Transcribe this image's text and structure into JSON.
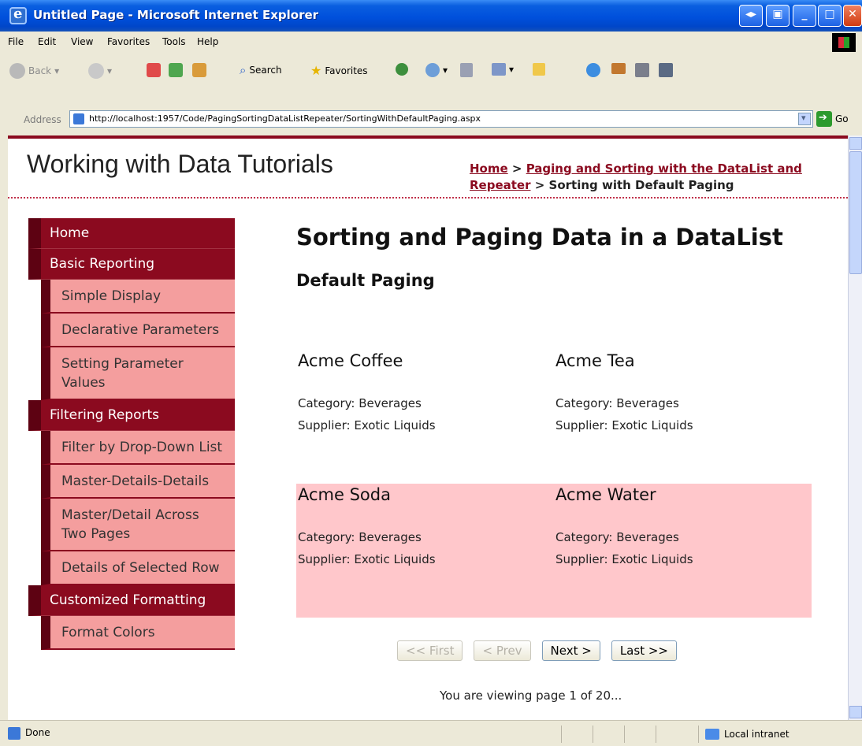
{
  "window": {
    "title": "Untitled Page - Microsoft Internet Explorer"
  },
  "menu": [
    "File",
    "Edit",
    "View",
    "Favorites",
    "Tools",
    "Help"
  ],
  "toolbar": {
    "back": "Back",
    "search": "Search",
    "favorites": "Favorites"
  },
  "address": {
    "label": "Address",
    "url": "http://localhost:1957/Code/PagingSortingDataListRepeater/SortingWithDefaultPaging.aspx",
    "go": "Go"
  },
  "site": {
    "title": "Working with Data Tutorials"
  },
  "breadcrumb": {
    "home": "Home",
    "sep1": " > ",
    "parent": "Paging and Sorting with the DataList and Repeater",
    "sep2": " > ",
    "current": "Sorting with Default Paging"
  },
  "sidebar": [
    {
      "label": "Home",
      "type": "section"
    },
    {
      "label": "Basic Reporting",
      "type": "section"
    },
    {
      "label": "Simple Display",
      "type": "sub"
    },
    {
      "label": "Declarative Parameters",
      "type": "sub"
    },
    {
      "label": "Setting Parameter Values",
      "type": "sub"
    },
    {
      "label": "Filtering Reports",
      "type": "section"
    },
    {
      "label": "Filter by Drop-Down List",
      "type": "sub"
    },
    {
      "label": "Master-Details-Details",
      "type": "sub"
    },
    {
      "label": "Master/Detail Across Two Pages",
      "type": "sub"
    },
    {
      "label": "Details of Selected Row",
      "type": "sub"
    },
    {
      "label": "Customized Formatting",
      "type": "section"
    },
    {
      "label": "Format Colors",
      "type": "sub"
    }
  ],
  "main": {
    "heading": "Sorting and Paging Data in a DataList",
    "subheading": "Default Paging"
  },
  "products": [
    {
      "name": "Acme Coffee",
      "category": "Category: Beverages",
      "supplier": "Supplier: Exotic Liquids"
    },
    {
      "name": "Acme Tea",
      "category": "Category: Beverages",
      "supplier": "Supplier: Exotic Liquids"
    },
    {
      "name": "Acme Soda",
      "category": "Category: Beverages",
      "supplier": "Supplier: Exotic Liquids"
    },
    {
      "name": "Acme Water",
      "category": "Category: Beverages",
      "supplier": "Supplier: Exotic Liquids"
    }
  ],
  "pager": {
    "first": "<< First",
    "prev": "< Prev",
    "next": "Next >",
    "last": "Last >>"
  },
  "page_info": "You are viewing page 1 of 20...",
  "status": {
    "text": "Done",
    "zone": "Local intranet"
  },
  "colors": {
    "brand": "#8b0a1f",
    "menu_sub": "#f49e9e",
    "alt_row": "#ffc7cb"
  }
}
